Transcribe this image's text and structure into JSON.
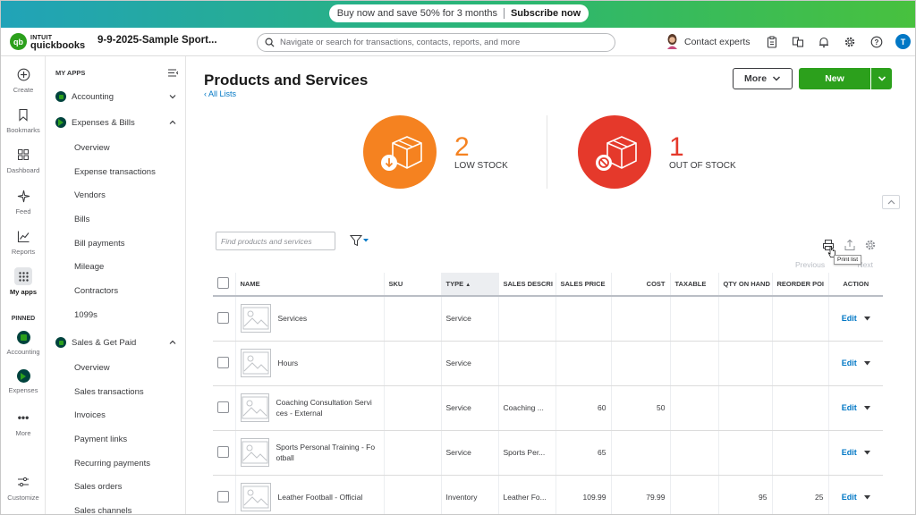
{
  "promo": {
    "text": "Buy now and save 50% for 3 months",
    "cta": "Subscribe now"
  },
  "topbar": {
    "brand_top": "INTUIT",
    "brand_name": "quickbooks",
    "company": "9-9-2025-Sample Sport...",
    "search_placeholder": "Navigate or search for transactions, contacts, reports, and more",
    "contact_label": "Contact experts",
    "user_initial": "T"
  },
  "rail": {
    "items": [
      {
        "label": "Create",
        "icon": "plus-circle-icon"
      },
      {
        "label": "Bookmarks",
        "icon": "bookmark-icon"
      },
      {
        "label": "Dashboard",
        "icon": "grid-icon"
      },
      {
        "label": "Feed",
        "icon": "sparkle-icon"
      },
      {
        "label": "Reports",
        "icon": "chart-icon"
      },
      {
        "label": "My apps",
        "icon": "apps-icon"
      }
    ],
    "pinned_label": "PINNED",
    "pinned": [
      {
        "label": "Accounting"
      },
      {
        "label": "Expenses"
      }
    ],
    "more_label": "More",
    "customize_label": "Customize"
  },
  "menu": {
    "header": "MY APPS",
    "accounting": "Accounting",
    "expenses": "Expenses & Bills",
    "expenses_items": [
      "Overview",
      "Expense transactions",
      "Vendors",
      "Bills",
      "Bill payments",
      "Mileage",
      "Contractors",
      "1099s"
    ],
    "sales": "Sales & Get Paid",
    "sales_items": [
      "Overview",
      "Sales transactions",
      "Invoices",
      "Payment links",
      "Recurring payments",
      "Sales orders",
      "Sales channels"
    ]
  },
  "page": {
    "title": "Products and Services",
    "back_link": "All Lists",
    "more_btn": "More",
    "new_btn": "New"
  },
  "stats": {
    "low_count": "2",
    "low_label": "LOW STOCK",
    "low_color": "#f58220",
    "out_count": "1",
    "out_label": "OUT OF STOCK",
    "out_color": "#e5392b"
  },
  "list": {
    "find_placeholder": "Find products and services",
    "pager_prev": "Previous",
    "pager_next": "Next",
    "tooltip": "Print list"
  },
  "table": {
    "headers": [
      "NAME",
      "SKU",
      "TYPE",
      "SALES DESCRI",
      "SALES PRICE",
      "COST",
      "TAXABLE",
      "QTY ON HAND",
      "REORDER POI",
      "ACTION"
    ],
    "rows": [
      {
        "name": "Services",
        "sku": "",
        "type": "Service",
        "desc": "",
        "price": "",
        "cost": "",
        "taxable": "",
        "qty": "",
        "reorder": "",
        "action": "Edit"
      },
      {
        "name": "Hours",
        "sku": "",
        "type": "Service",
        "desc": "",
        "price": "",
        "cost": "",
        "taxable": "",
        "qty": "",
        "reorder": "",
        "action": "Edit"
      },
      {
        "name": "Coaching Consultation Servi ces - External",
        "sku": "",
        "type": "Service",
        "desc": "Coaching ...",
        "price": "60",
        "cost": "50",
        "taxable": "",
        "qty": "",
        "reorder": "",
        "action": "Edit"
      },
      {
        "name": "Sports Personal Training - Fo otball",
        "sku": "",
        "type": "Service",
        "desc": "Sports Per...",
        "price": "65",
        "cost": "",
        "taxable": "",
        "qty": "",
        "reorder": "",
        "action": "Edit"
      },
      {
        "name": "Leather Football - Official",
        "sku": "",
        "type": "Inventory",
        "desc": "Leather Fo...",
        "price": "109.99",
        "cost": "79.99",
        "taxable": "",
        "qty": "95",
        "reorder": "25",
        "action": "Edit"
      }
    ]
  }
}
